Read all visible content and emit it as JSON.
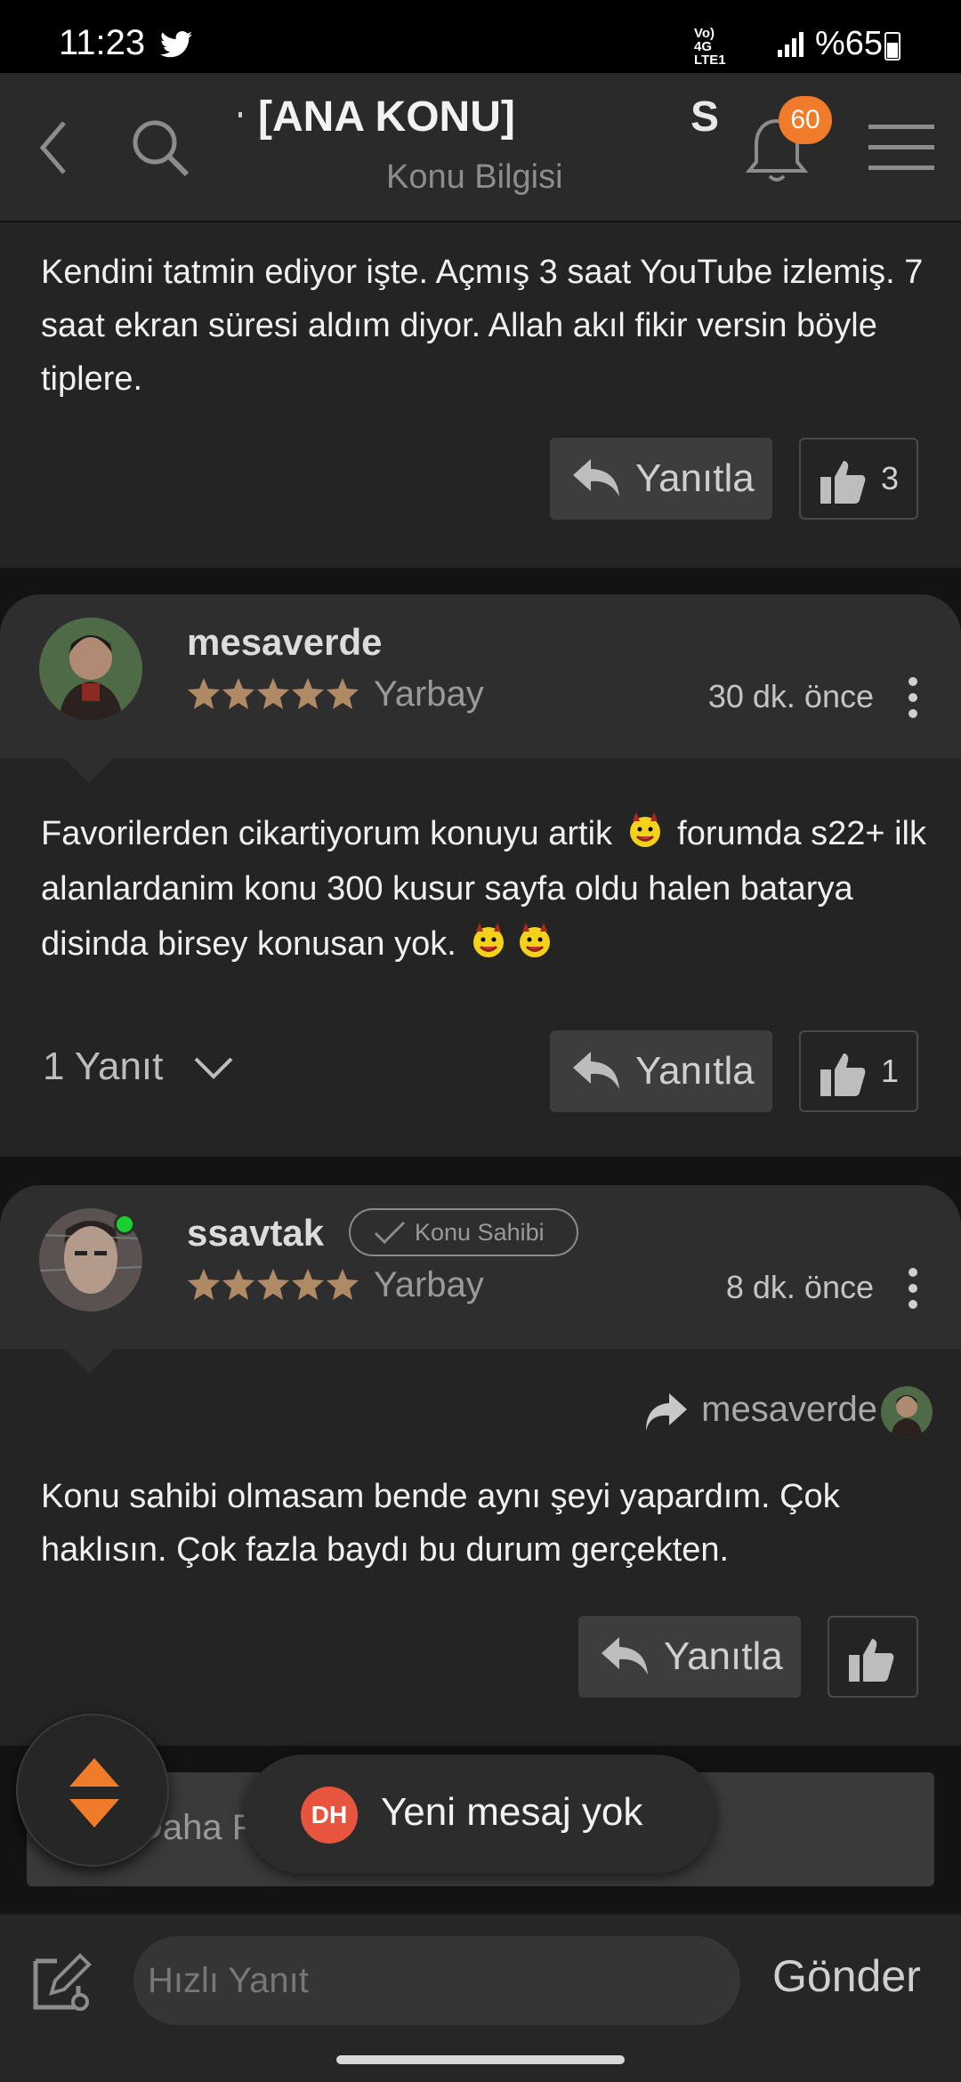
{
  "status_bar": {
    "time": "11:23",
    "network": "Vo) 4G LTE1",
    "battery": "%65"
  },
  "header": {
    "title": "[ANA KONU]",
    "subtitle": "Konu Bilgisi",
    "letter": "S",
    "notification_count": "60"
  },
  "top_post": {
    "text": "Kendini tatmin ediyor işte. Açmış 3 saat YouTube izlemiş. 7 saat ekran süresi aldım diyor. Allah akıl fikir versin böyle tiplere.",
    "reply_label": "Yanıtla",
    "like_count": "3"
  },
  "posts": [
    {
      "username": "mesaverde",
      "rank": "Yarbay",
      "time_ago": "30 dk. önce",
      "text_1": "Favorilerden cikartiyorum konuyu artik",
      "text_2": "forumda s22+ ilk alanlardanim konu 300 kusur sayfa oldu halen batarya disinda birsey konusan yok.",
      "replies_label": "1 Yanıt",
      "reply_label": "Yanıtla",
      "like_count": "1"
    },
    {
      "username": "ssavtak",
      "owner_tag": "Konu Sahibi",
      "rank": "Yarbay",
      "time_ago": "8 dk. önce",
      "quoted_user": "mesaverde",
      "text": "Konu sahibi olmasam bende aynı şeyi yapardım. Çok haklısın. Çok fazla baydı bu durum gerçekten.",
      "reply_label": "Yanıtla"
    }
  ],
  "load_more": {
    "label": "Daha Fazla Yan"
  },
  "toast": {
    "badge": "DH",
    "message": "Yeni mesaj yok"
  },
  "composer": {
    "placeholder": "Hızlı Yanıt",
    "send_label": "Gönder"
  },
  "colors": {
    "accent": "#f07b2a",
    "star": "#b08a64",
    "online": "#18d030"
  }
}
